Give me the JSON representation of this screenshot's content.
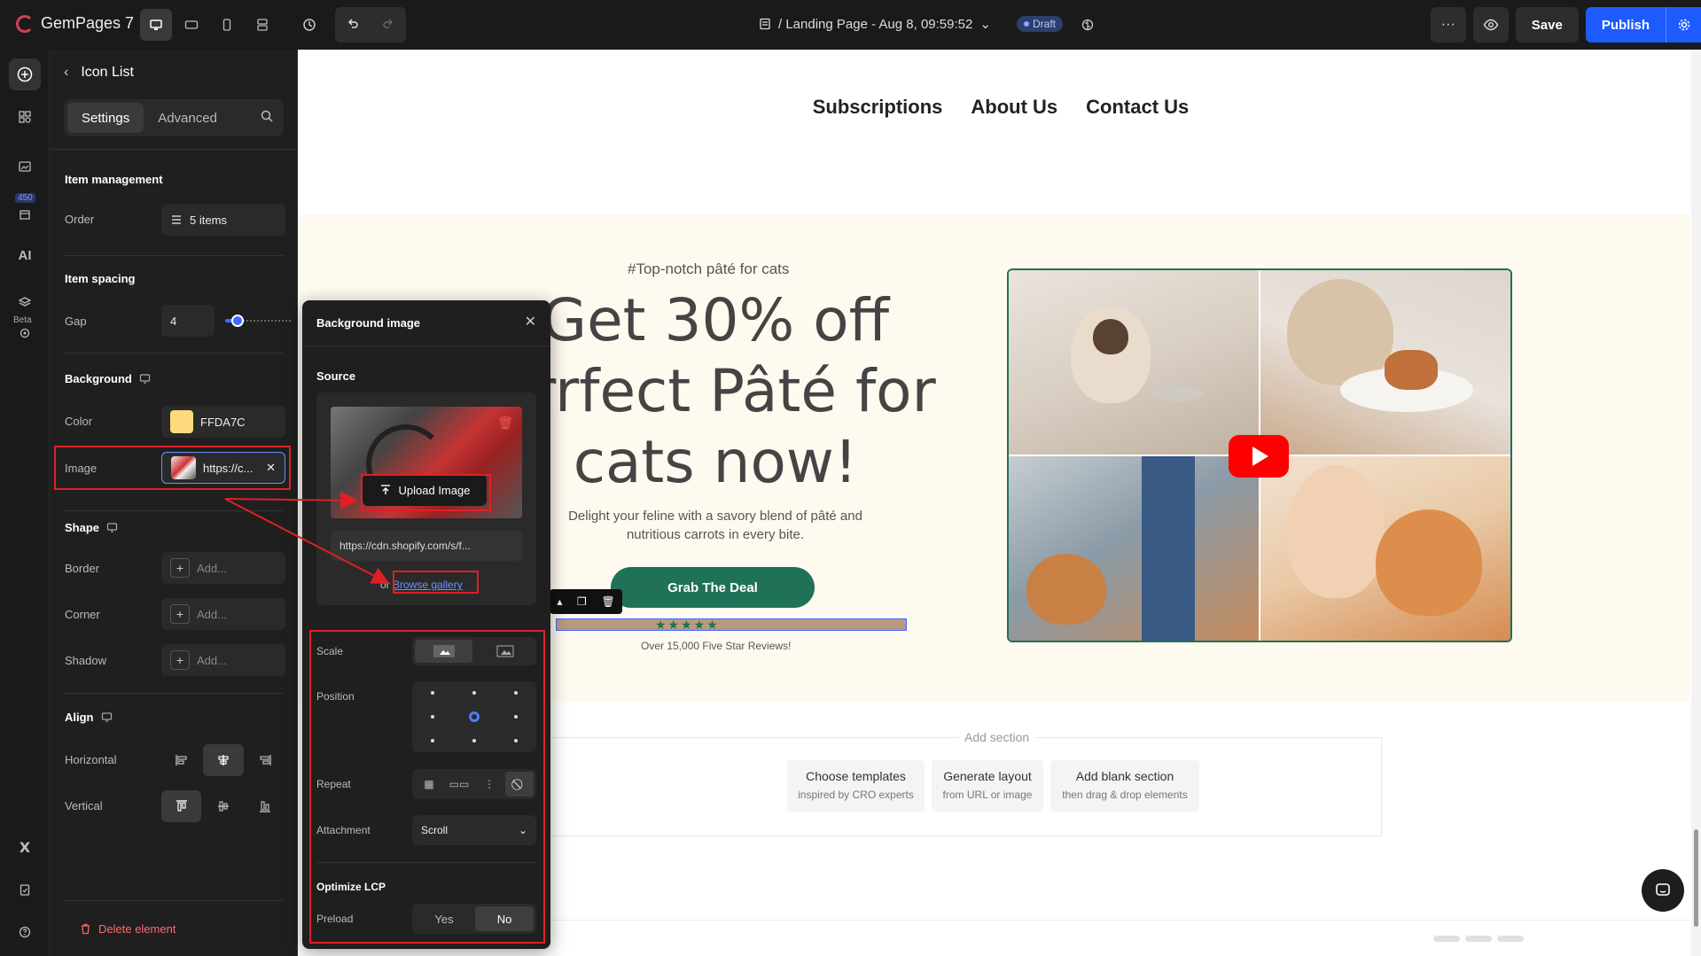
{
  "app": {
    "logo_text": "GemPages 7",
    "page_title": "/ Landing Page - Aug 8, 09:59:52",
    "draft_label": "Draft",
    "save_label": "Save",
    "publish_label": "Publish",
    "more_glyph": "···"
  },
  "rail": {
    "badge_count": "450",
    "ai_label": "AI",
    "beta_label": "Beta"
  },
  "panel": {
    "title": "Icon List",
    "tabs": [
      "Settings",
      "Advanced"
    ],
    "item_management": "Item management",
    "order_label": "Order",
    "order_value": "5 items",
    "item_spacing": "Item spacing",
    "gap_label": "Gap",
    "gap_value": "4",
    "gap_slider_fraction": 0.12,
    "background": "Background",
    "color_label": "Color",
    "color_value": "FFDA7C",
    "image_label": "Image",
    "image_value": "https://c...",
    "shape": "Shape",
    "border_label": "Border",
    "corner_label": "Corner",
    "shadow_label": "Shadow",
    "add_placeholder": "Add...",
    "align": "Align",
    "horizontal_label": "Horizontal",
    "vertical_label": "Vertical",
    "delete_label": "Delete element"
  },
  "canvas": {
    "nav": [
      "Subscriptions",
      "About Us",
      "Contact Us"
    ],
    "hero_tag": "#Top-notch pâté for cats",
    "hero_lines": [
      "Get 30% off",
      "urrfect Pâté for",
      "cats now!"
    ],
    "hero_desc": "Delight your feline with a savory blend of pâté and nutritious carrots in every bite.",
    "cta": "Grab The Deal",
    "stars": "★★★★★",
    "reviews": "Over 15,000 Five Star Reviews!",
    "add_section": "Add section",
    "add_options": [
      {
        "title": "Choose templates",
        "sub": "inspired by CRO experts"
      },
      {
        "title": "Generate layout",
        "sub": "from URL or image"
      },
      {
        "title": "Add blank section",
        "sub": "then drag & drop elements"
      }
    ]
  },
  "popup": {
    "title": "Background image",
    "source_label": "Source",
    "upload_label": "Upload Image",
    "url_value": "https://cdn.shopify.com/s/f...",
    "or_text": "or",
    "browse_label": "Browse gallery",
    "scale_label": "Scale",
    "position_label": "Position",
    "repeat_label": "Repeat",
    "attachment_label": "Attachment",
    "attachment_value": "Scroll",
    "lcp_title": "Optimize LCP",
    "preload_label": "Preload",
    "preload_yes": "Yes",
    "preload_no": "No"
  },
  "colors": {
    "brand_green": "#1f7158",
    "accent_blue": "#1e5bff",
    "highlight_red": "#e01f26",
    "bg_swatch": "#FFDA7C"
  }
}
